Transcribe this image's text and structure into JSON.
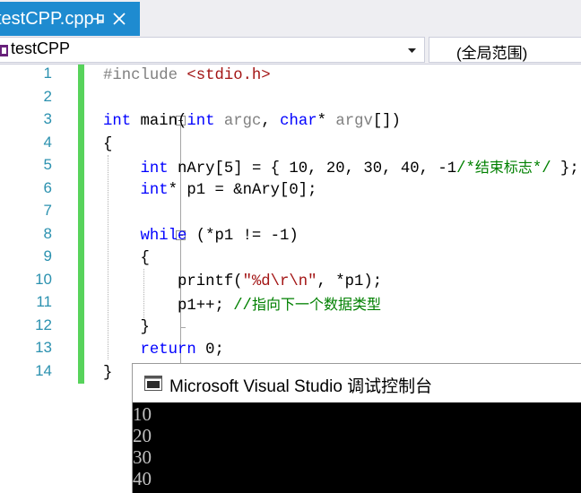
{
  "tab": {
    "title": "testCPP.cpp"
  },
  "navbar": {
    "project": "testCPP",
    "scope": "(全局范围)"
  },
  "editor": {
    "line_numbers": [
      "1",
      "2",
      "3",
      "4",
      "5",
      "6",
      "7",
      "8",
      "9",
      "10",
      "11",
      "12",
      "13",
      "14"
    ],
    "lines": [
      [
        {
          "t": "#include ",
          "c": "pp"
        },
        {
          "t": "<stdio.h>",
          "c": "str"
        }
      ],
      [],
      [
        {
          "t": "int",
          "c": "kw"
        },
        {
          "t": " main("
        },
        {
          "t": "int",
          "c": "kw"
        },
        {
          "t": " "
        },
        {
          "t": "argc",
          "c": "prm"
        },
        {
          "t": ", "
        },
        {
          "t": "char",
          "c": "kw"
        },
        {
          "t": "* "
        },
        {
          "t": "argv",
          "c": "prm"
        },
        {
          "t": "[])"
        }
      ],
      [
        {
          "t": "{"
        }
      ],
      [
        {
          "t": "    "
        },
        {
          "t": "int",
          "c": "kw"
        },
        {
          "t": " nAry[5] = { 10, 20, 30, 40, -1"
        },
        {
          "t": "/*",
          "c": "cm"
        },
        {
          "t": "结束标志",
          "c": "cm cn"
        },
        {
          "t": "*/",
          "c": "cm"
        },
        {
          "t": " };"
        }
      ],
      [
        {
          "t": "    "
        },
        {
          "t": "int",
          "c": "kw"
        },
        {
          "t": "* p1 = &nAry[0];"
        }
      ],
      [],
      [
        {
          "t": "    "
        },
        {
          "t": "while",
          "c": "kw"
        },
        {
          "t": " (*p1 != -1)"
        }
      ],
      [
        {
          "t": "    {"
        }
      ],
      [
        {
          "t": "        printf("
        },
        {
          "t": "\"%d\\r\\n\"",
          "c": "str"
        },
        {
          "t": ", *p1);"
        }
      ],
      [
        {
          "t": "        p1++; "
        },
        {
          "t": "//",
          "c": "cm"
        },
        {
          "t": "指向下一个数据类型",
          "c": "cm cn"
        }
      ],
      [
        {
          "t": "    }"
        }
      ],
      [
        {
          "t": "    "
        },
        {
          "t": "return",
          "c": "kw"
        },
        {
          "t": " 0;"
        }
      ],
      [
        {
          "t": "}"
        }
      ]
    ]
  },
  "console": {
    "title": "Microsoft Visual Studio 调试控制台",
    "output": [
      "10",
      "20",
      "30",
      "40"
    ]
  },
  "colors": {
    "tab_active": "#1e8bd0",
    "keyword": "#0000ff",
    "string": "#a31515",
    "comment": "#008000",
    "line_number": "#2b91af",
    "change_bar": "#57d35b"
  },
  "icons": {
    "pin": "pin-icon",
    "close": "close-icon",
    "project": "cpp-project-icon",
    "dropdown": "chevron-down-icon",
    "console": "console-window-icon"
  }
}
